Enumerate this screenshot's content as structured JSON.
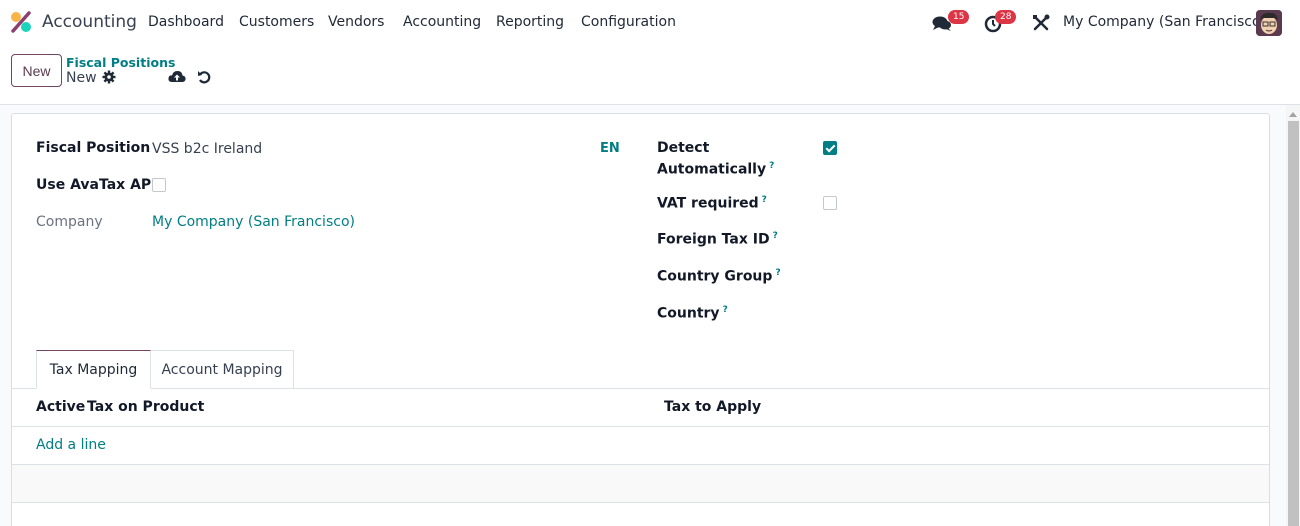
{
  "navbar": {
    "app_name": "Accounting",
    "menu": [
      "Dashboard",
      "Customers",
      "Vendors",
      "Accounting",
      "Reporting",
      "Configuration"
    ],
    "messages_count": "15",
    "activities_count": "28",
    "company": "My Company (San Francisco)"
  },
  "control_panel": {
    "new_button": "New",
    "breadcrumb": "Fiscal Positions",
    "record_name": "New"
  },
  "form": {
    "fiscal_position_label": "Fiscal Position",
    "fiscal_position_value": "VSS b2c Ireland",
    "avatax_label": "Use AvaTax API",
    "avatax_checked": false,
    "company_label": "Company",
    "company_value": "My Company (San Francisco)",
    "lang_button": "EN",
    "detect_label_1": "Detect",
    "detect_label_2": "Automatically",
    "detect_checked": true,
    "vat_required_label": "VAT required",
    "vat_required_checked": false,
    "foreign_tax_label": "Foreign Tax ID",
    "country_group_label": "Country Group",
    "country_label": "Country",
    "help_mark": "?"
  },
  "tabs": [
    {
      "label": "Tax Mapping",
      "active": true
    },
    {
      "label": "Account Mapping",
      "active": false
    }
  ],
  "table": {
    "columns": [
      "Active",
      "Tax on Product",
      "Tax to Apply"
    ],
    "add_line": "Add a line"
  },
  "colors": {
    "brand": "#71445f",
    "accent": "#017e84",
    "badge": "#dc3545"
  }
}
